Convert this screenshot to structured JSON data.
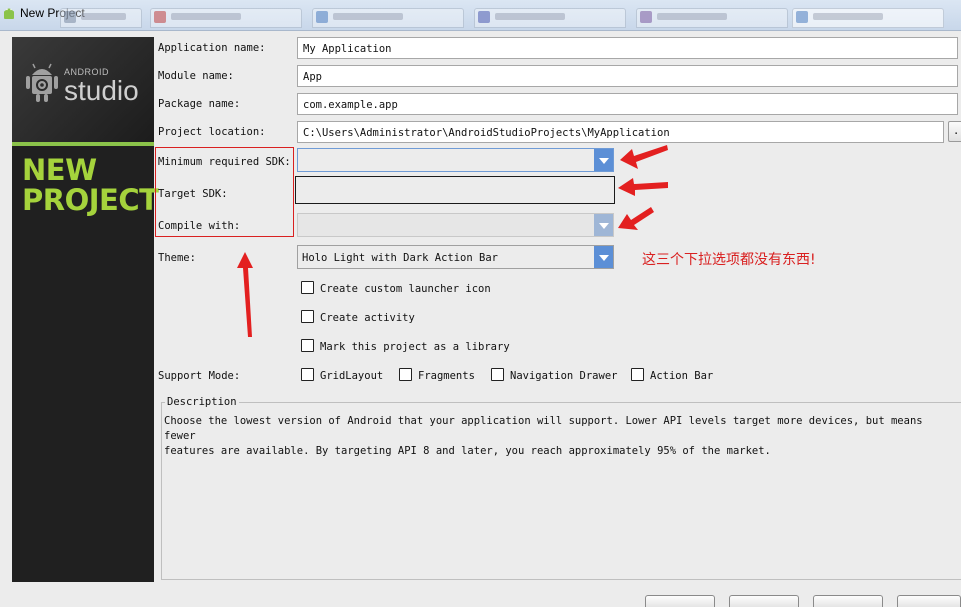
{
  "window": {
    "title": "New Project"
  },
  "banner": {
    "brand_small": "ANDROID",
    "brand_big": "studio",
    "line1": "NEW",
    "line2": "PROJECT"
  },
  "form": {
    "app_name_label": "Application name:",
    "app_name_value": "My Application",
    "module_name_label": "Module name:",
    "module_name_value": "App",
    "package_name_label": "Package name:",
    "package_name_value": "com.example.app",
    "project_location_label": "Project location:",
    "project_location_value": "C:\\Users\\Administrator\\AndroidStudioProjects\\MyApplication",
    "browse_label": "...",
    "min_sdk_label": "Minimum required SDK:",
    "min_sdk_value": "",
    "target_sdk_label": "Target SDK:",
    "target_sdk_value": "",
    "compile_with_label": "Compile with:",
    "compile_with_value": "",
    "theme_label": "Theme:",
    "theme_value": "Holo Light with Dark Action Bar"
  },
  "checkboxes": {
    "custom_launcher_icon": "Create custom launcher icon",
    "create_activity": "Create activity",
    "mark_library": "Mark this project as a library"
  },
  "support_mode": {
    "label": "Support Mode:",
    "grid_layout": "GridLayout",
    "fragments": "Fragments",
    "navigation_drawer": "Navigation Drawer",
    "action_bar": "Action Bar"
  },
  "description": {
    "title": "Description",
    "line1": "Choose the lowest version of Android that your application will support. Lower API levels target more devices, but means fewer",
    "line2": "features are available. By targeting API 8 and later, you reach approximately 95% of the market."
  },
  "annotation": {
    "text": "这三个下拉选项都没有东西!",
    "color": "#d92020"
  },
  "colors": {
    "accent_green": "#a5d33c",
    "combo_arrow_blue": "#5c8fd6"
  }
}
